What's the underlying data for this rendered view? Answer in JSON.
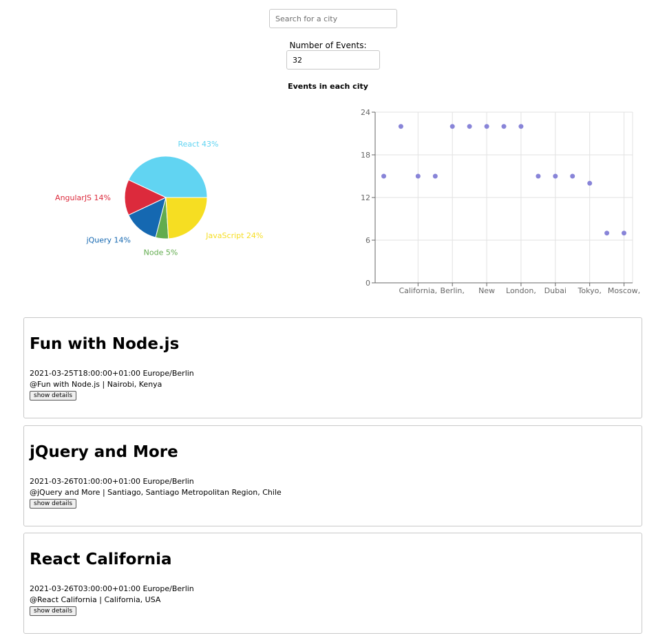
{
  "search": {
    "placeholder": "Search for a city",
    "value": ""
  },
  "events_count": {
    "label": "Number of Events:",
    "value": "32"
  },
  "chart_heading": "Events in each city",
  "chart_data": [
    {
      "type": "pie",
      "slices": [
        {
          "label": "React 43%",
          "value": 43,
          "color": "#61d4f2"
        },
        {
          "label": "AngularJS 14%",
          "value": 14,
          "color": "#dc2a3c"
        },
        {
          "label": "jQuery 14%",
          "value": 14,
          "color": "#1568b1"
        },
        {
          "label": "Node 5%",
          "value": 5,
          "color": "#62ac4e"
        },
        {
          "label": "JavaScript 24%",
          "value": 24,
          "color": "#f6de22"
        }
      ]
    },
    {
      "type": "scatter",
      "x_tick_labels": [
        "California,",
        "Berlin,",
        "New",
        "London,",
        "Dubai",
        "Tokyo,",
        "Moscow,"
      ],
      "y": [
        15,
        22,
        15,
        15,
        22,
        22,
        22,
        22,
        22,
        15,
        15,
        15,
        14,
        7,
        7
      ],
      "yticks": [
        0,
        6,
        12,
        18,
        24
      ],
      "ylim": [
        0,
        24
      ],
      "grid": true,
      "point_color": "#8884d8"
    }
  ],
  "events": [
    {
      "title": "Fun with Node.js",
      "time": "2021-03-25T18:00:00+01:00 Europe/Berlin",
      "location": "@Fun with Node.js | Nairobi, Kenya",
      "button": "show details"
    },
    {
      "title": "jQuery and More",
      "time": "2021-03-26T01:00:00+01:00 Europe/Berlin",
      "location": "@jQuery and More | Santiago, Santiago Metropolitan Region, Chile",
      "button": "show details"
    },
    {
      "title": "React California",
      "time": "2021-03-26T03:00:00+01:00 Europe/Berlin",
      "location": "@React California | California, USA",
      "button": "show details"
    }
  ]
}
